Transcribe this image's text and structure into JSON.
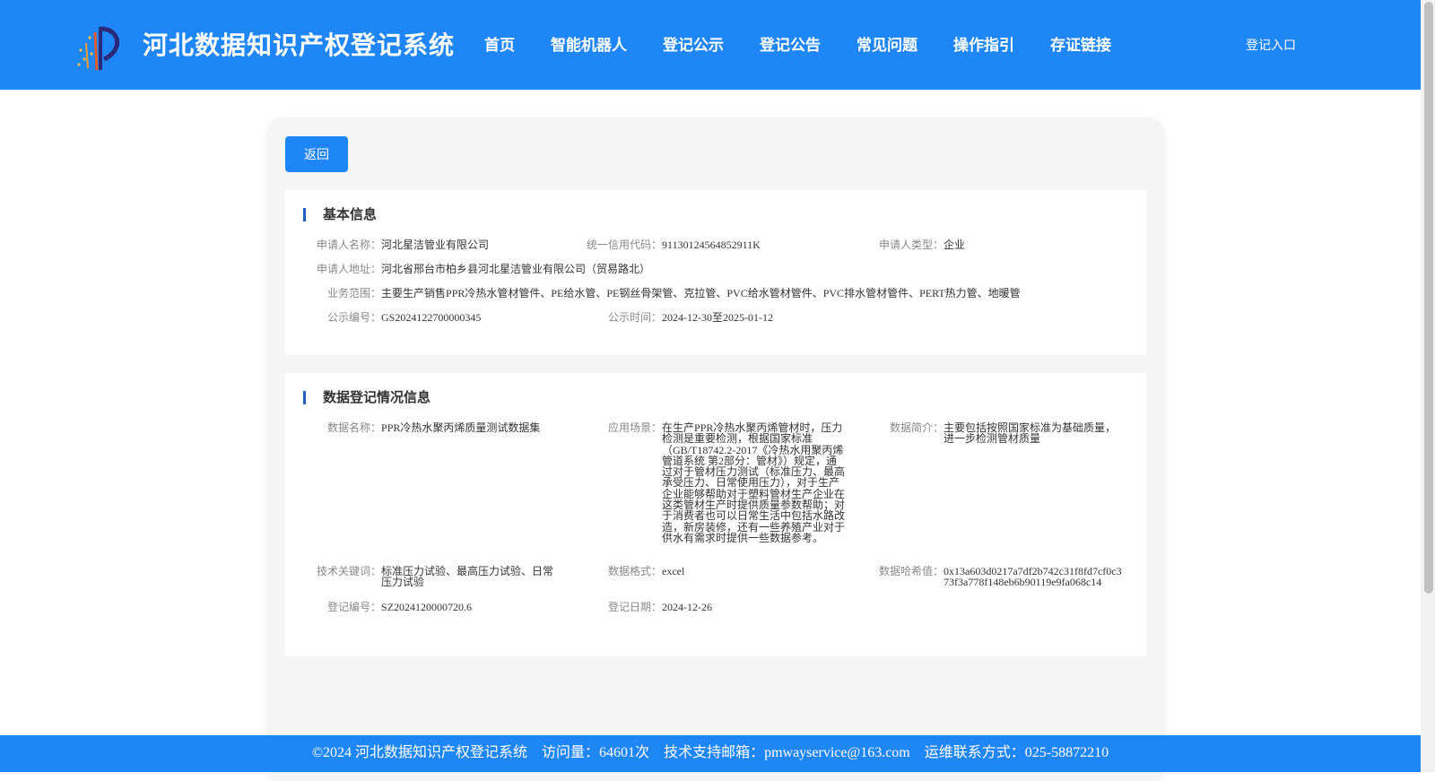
{
  "header": {
    "site_title": "河北数据知识产权登记系统",
    "login_label": "登记入口",
    "nav": [
      "首页",
      "智能机器人",
      "登记公示",
      "登记公告",
      "常见问题",
      "操作指引",
      "存证链接"
    ]
  },
  "card": {
    "back_label": "返回",
    "basic": {
      "title": "基本信息",
      "applicant_name_label": "申请人名称：",
      "applicant_name": "河北星洁管业有限公司",
      "credit_code_label": "统一信用代码：",
      "credit_code": "91130124564852911K",
      "applicant_type_label": "申请人类型：",
      "applicant_type": "企业",
      "address_label": "申请人地址：",
      "address": "河北省邢台市柏乡县河北星洁管业有限公司（贸易路北）",
      "scope_label": "业务范围：",
      "scope": "主要生产销售PPR冷热水管材管件、PE给水管、PE钢丝骨架管、克拉管、PVC给水管材管件、PVC排水管材管件、PERT热力管、地暖管",
      "notice_no_label": "公示编号：",
      "notice_no": "GS2024122700000345",
      "notice_time_label": "公示时间：",
      "notice_time": "2024-12-30至2025-01-12"
    },
    "data": {
      "title": "数据登记情况信息",
      "data_name_label": "数据名称：",
      "data_name": "PPR冷热水聚丙烯质量测试数据集",
      "scenario_label": "应用场景：",
      "scenario": "在生产PPR冷热水聚丙烯管材时，压力检测是重要检测，根据国家标准（GB/T18742.2-2017《冷热水用聚丙烯管道系统 第2部分：管材》）规定，通过对于管材压力测试（标准压力、最高承受压力、日常使用压力），对于生产企业能够帮助对于塑料管材生产企业在这类管材生产时提供质量参数帮助；对于消费者也可以日常生活中包括水路改造，新房装修，还有一些养殖产业对于供水有需求时提供一些数据参考。",
      "summary_label": "数据简介：",
      "summary": "主要包括按照国家标准为基础质量，进一步检测管材质量",
      "keywords_label": "技术关键词：",
      "keywords": "标准压力试验、最高压力试验、日常压力试验",
      "format_label": "数据格式：",
      "format": "excel",
      "hash_label": "数据哈希值：",
      "hash": "0x13a603d0217a7df2b742c31f8fd7cf0c373f3a778f148eb6b90119e9fa068c14",
      "reg_no_label": "登记编号：",
      "reg_no": "SZ2024120000720.6",
      "reg_date_label": "登记日期：",
      "reg_date": "2024-12-26"
    }
  },
  "footer": {
    "copyright": "©2024 河北数据知识产权登记系统",
    "visits": "访问量：64601次",
    "email": "技术支持邮箱：pmwayservice@163.com",
    "phone": "运维联系方式：025-58872210"
  },
  "colors": {
    "brand": "#1f86f7",
    "accent_bar": "#1f5fc0"
  },
  "icons": {
    "logo": "logo-icon"
  }
}
